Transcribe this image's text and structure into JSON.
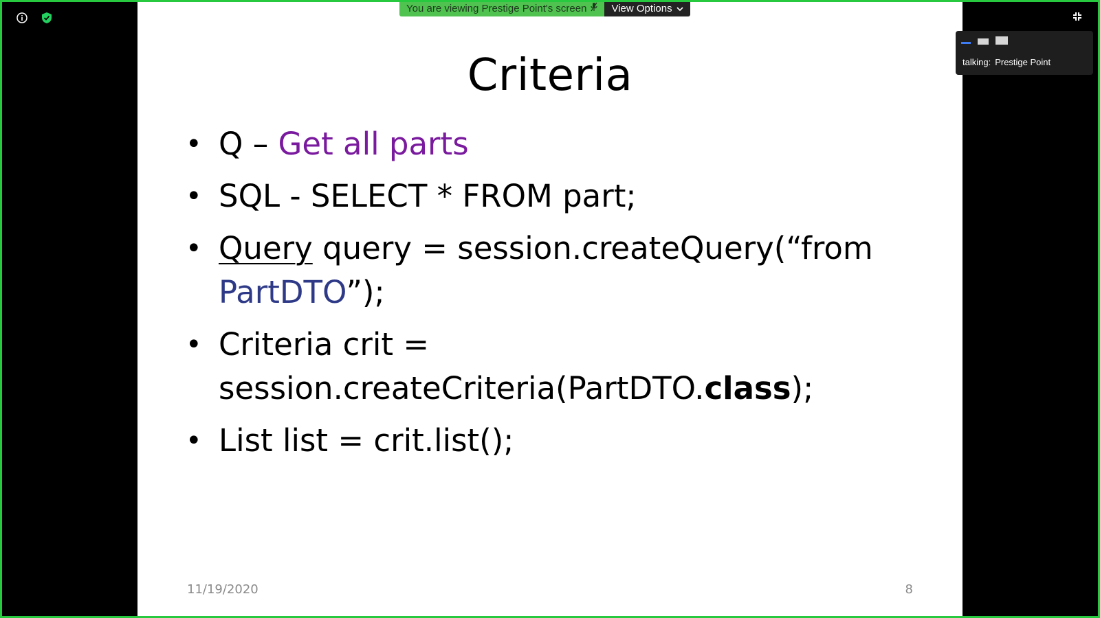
{
  "banner": {
    "viewing_text": "You are viewing Prestige Point's screen",
    "view_options_label": "View Options"
  },
  "talking": {
    "label": "talking:",
    "name": "Prestige Point"
  },
  "slide": {
    "title": "Criteria",
    "bullets": {
      "b1": {
        "prefix": "Q – ",
        "highlight": "Get all parts"
      },
      "b2": {
        "text": "SQL - SELECT * FROM part;"
      },
      "b3": {
        "keyword": "Query",
        "middle": " query = session.createQuery(“from ",
        "entity": "PartDTO",
        "suffix": "”);"
      },
      "b4": {
        "prefix": "Criteria crit = session.createCriteria(PartDTO.",
        "bold": "class",
        "suffix": ");"
      },
      "b5": {
        "text": "List list = crit.list();"
      }
    },
    "date": "11/19/2020",
    "page_number": "8"
  },
  "colors": {
    "frame": "#27c93f",
    "highlight_purple": "#7a1a9e",
    "entity_navy": "#2e3a87",
    "banner_green": "#4fc24f",
    "shield_green": "#23d160"
  },
  "icons": [
    "info-icon",
    "shield-icon",
    "microphone-icon",
    "chevron-down-icon",
    "exit-fullscreen-icon"
  ]
}
